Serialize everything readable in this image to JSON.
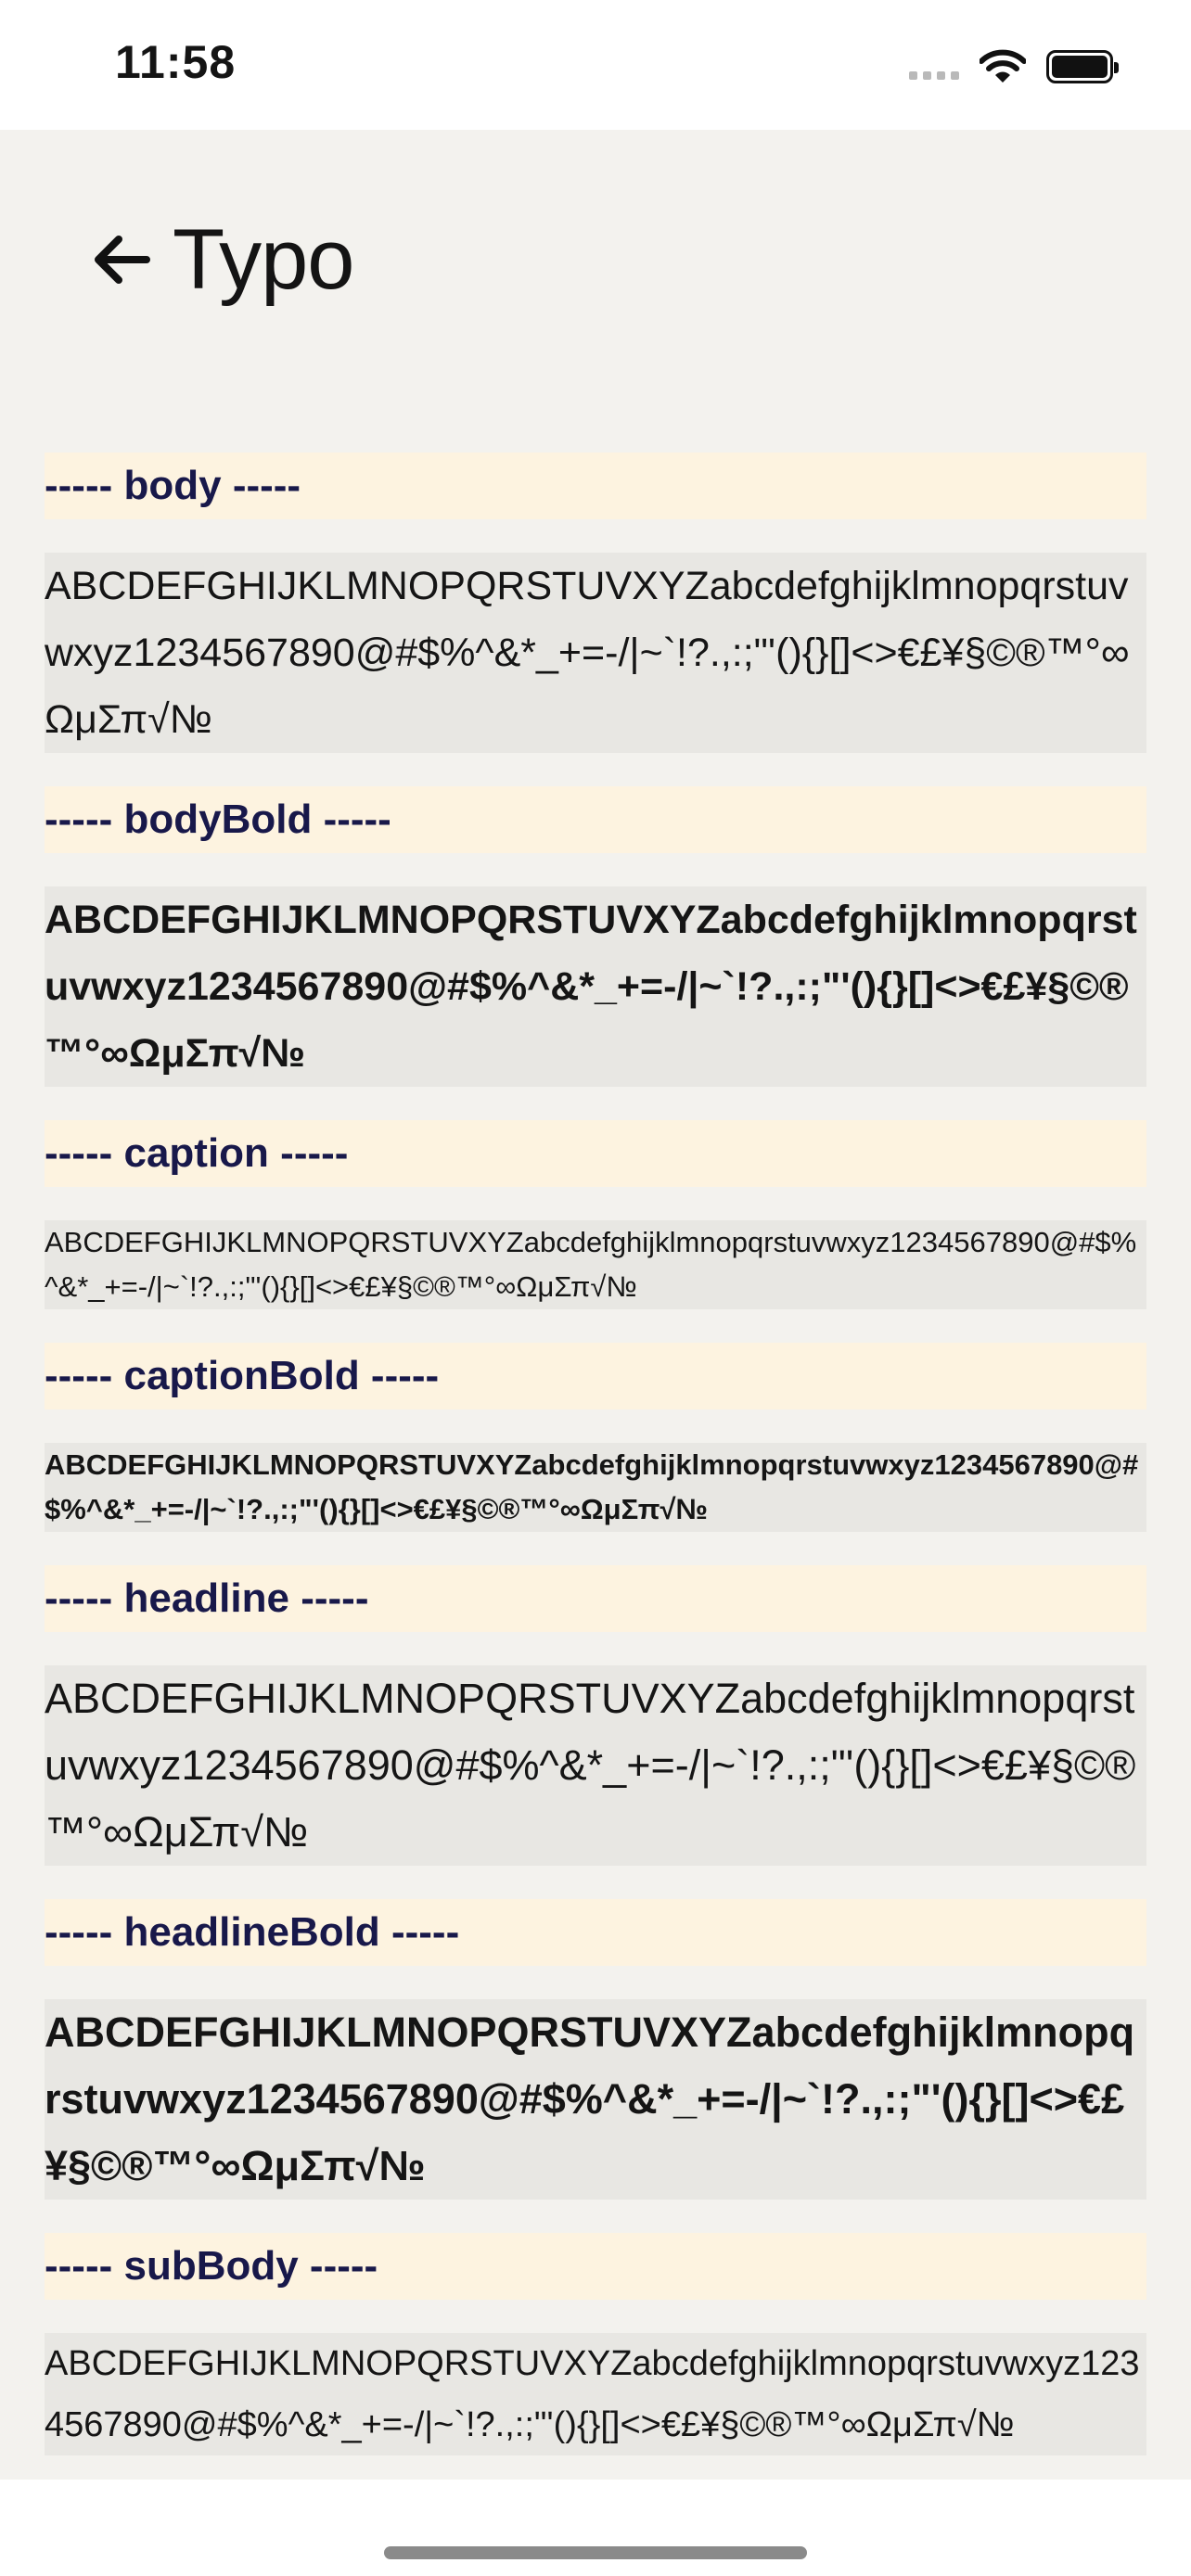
{
  "status_bar": {
    "time": "11:58"
  },
  "nav": {
    "title": "Typo"
  },
  "sections": [
    {
      "header": "----- body -----",
      "sample": "ABCDEFGHIJKLMNOPQRSTUVXYZabcdefghijklmnopqrstuvwxyz1234567890@#$%^&*_+=-/|~`!?.,:;\"'(){}[]<>€£¥§©®™°∞ΩμΣπ√№"
    },
    {
      "header": "----- bodyBold -----",
      "sample": "ABCDEFGHIJKLMNOPQRSTUVXYZabcdefghijklmnopqrstuvwxyz1234567890@#$%^&*_+=-/|~`!?.,:;\"'(){}[]<>€£¥§©®™°∞ΩμΣπ√№"
    },
    {
      "header": "----- caption -----",
      "sample": "ABCDEFGHIJKLMNOPQRSTUVXYZabcdefghijklmnopqrstuvwxyz1234567890@#$%^&*_+=-/|~`!?.,:;\"'(){}[]<>€£¥§©®™°∞ΩμΣπ√№"
    },
    {
      "header": "----- captionBold -----",
      "sample": "ABCDEFGHIJKLMNOPQRSTUVXYZabcdefghijklmnopqrstuvwxyz1234567890@#$%^&*_+=-/|~`!?.,:;\"'(){}[]<>€£¥§©®™°∞ΩμΣπ√№"
    },
    {
      "header": "----- headline -----",
      "sample": "ABCDEFGHIJKLMNOPQRSTUVXYZabcdefghijklmnopqrstuvwxyz1234567890@#$%^&*_+=-/|~`!?.,:;\"'(){}[]<>€£¥§©®™°∞ΩμΣπ√№"
    },
    {
      "header": "----- headlineBold -----",
      "sample": "ABCDEFGHIJKLMNOPQRSTUVXYZabcdefghijklmnopqrstuvwxyz1234567890@#$%^&*_+=-/|~`!?.,:;\"'(){}[]<>€£¥§©®™°∞ΩμΣπ√№"
    },
    {
      "header": "----- subBody -----",
      "sample": "ABCDEFGHIJKLMNOPQRSTUVXYZabcdefghijklmnopqrstuvwxyz1234567890@#$%^&*_+=-/|~`!?.,:;\"'(){}[]<>€£¥§©®™°∞ΩμΣπ√№"
    }
  ],
  "icons": {
    "back": "arrow-left-icon",
    "wifi": "wifi-icon",
    "battery": "battery-icon",
    "signal": "cellular-signal-icon"
  },
  "colors": {
    "header_bg": "#fdf3e0",
    "header_text": "#18184a",
    "sample_bg": "#e8e7e3",
    "page_bg": "#f3f2ee"
  }
}
